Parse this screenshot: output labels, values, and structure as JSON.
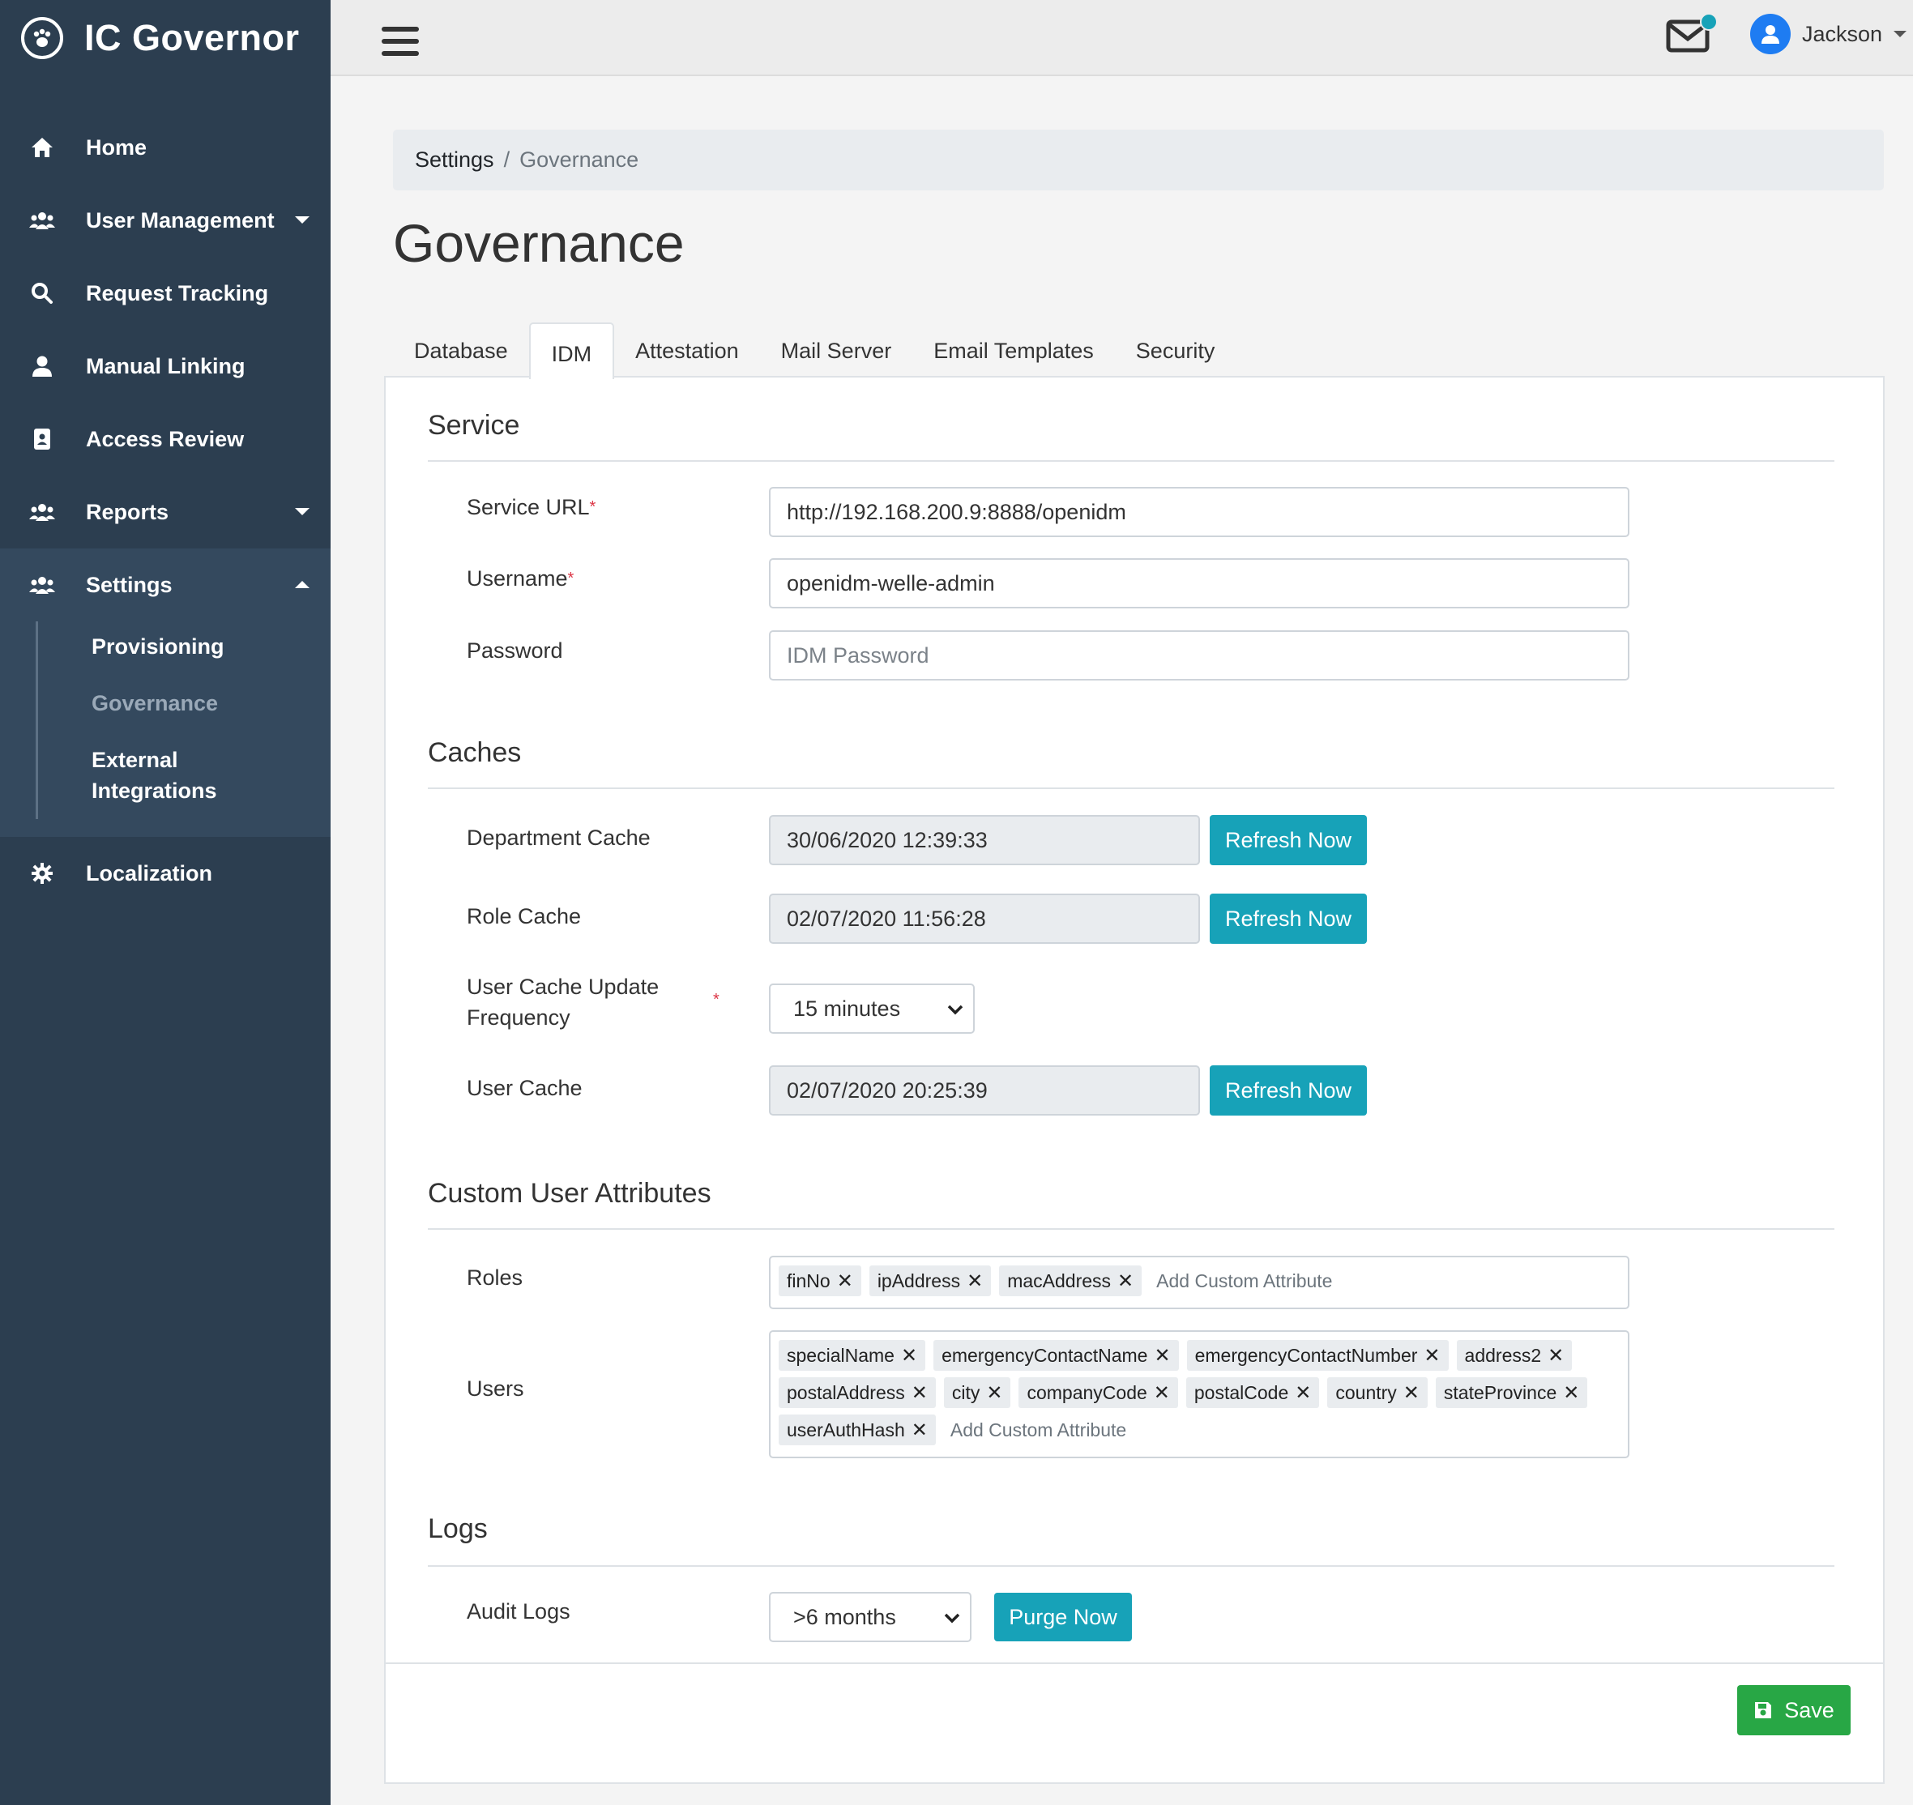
{
  "app": {
    "title": "IC Governor"
  },
  "sidebar": {
    "items": [
      {
        "label": "Home",
        "icon": "home-icon"
      },
      {
        "label": "User Management",
        "icon": "users-icon"
      },
      {
        "label": "Request Tracking",
        "icon": "search-icon"
      },
      {
        "label": "Manual Linking",
        "icon": "user-icon"
      },
      {
        "label": "Access Review",
        "icon": "id-badge-icon"
      },
      {
        "label": "Reports",
        "icon": "users-icon"
      },
      {
        "label": "Settings",
        "icon": "users-icon"
      },
      {
        "label": "Localization",
        "icon": "gear-icon"
      }
    ],
    "settings_sub": [
      {
        "label": "Provisioning"
      },
      {
        "label": "Governance"
      },
      {
        "label": "External Integrations"
      }
    ]
  },
  "topbar": {
    "user_name": "Jackson"
  },
  "breadcrumb": {
    "parent": "Settings",
    "separator": "/",
    "current": "Governance"
  },
  "page": {
    "title": "Governance"
  },
  "tabs": [
    "Database",
    "IDM",
    "Attestation",
    "Mail Server",
    "Email Templates",
    "Security"
  ],
  "service": {
    "title": "Service",
    "url_label": "Service URL",
    "url_value": "http://192.168.200.9:8888/openidm",
    "username_label": "Username",
    "username_value": "openidm-welle-admin",
    "password_label": "Password",
    "password_placeholder": "IDM Password"
  },
  "caches": {
    "title": "Caches",
    "department_label": "Department Cache",
    "department_value": "30/06/2020 12:39:33",
    "role_label": "Role Cache",
    "role_value": "02/07/2020 11:56:28",
    "frequency_label": "User Cache Update Frequency",
    "frequency_value": "15 minutes",
    "user_label": "User Cache",
    "user_value": "02/07/2020 20:25:39",
    "refresh_label": "Refresh Now"
  },
  "custom_attrs": {
    "title": "Custom User Attributes",
    "roles_label": "Roles",
    "roles_tags": [
      "finNo",
      "ipAddress",
      "macAddress"
    ],
    "users_label": "Users",
    "users_tags": [
      "specialName",
      "emergencyContactName",
      "emergencyContactNumber",
      "address2",
      "postalAddress",
      "city",
      "companyCode",
      "postalCode",
      "country",
      "stateProvince",
      "userAuthHash"
    ],
    "placeholder": "Add Custom Attribute",
    "remove_glyph": "✕"
  },
  "logs": {
    "title": "Logs",
    "audit_label": "Audit Logs",
    "audit_value": ">6 months",
    "purge_label": "Purge Now"
  },
  "actions": {
    "save_label": "Save"
  },
  "colors": {
    "sidebar": "#2c3e50",
    "info": "#17a2b8",
    "success": "#28a745",
    "required": "#dc3545"
  }
}
